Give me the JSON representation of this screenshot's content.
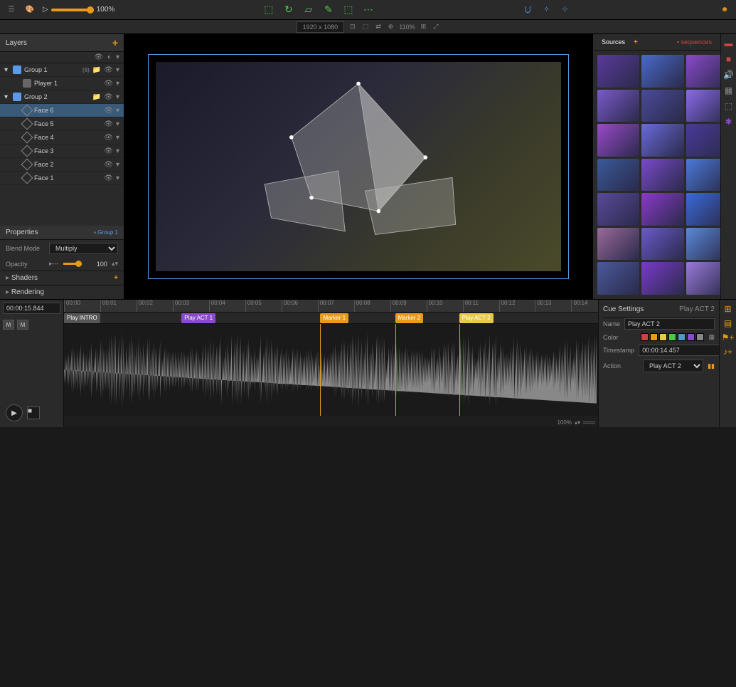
{
  "toolbar": {
    "zoom_percent": "100%",
    "canvas_dimensions": "1920 x 1080",
    "transform_percent": "110%"
  },
  "layers_panel": {
    "title": "Layers",
    "items": [
      {
        "name": "Group 1",
        "type": "group",
        "count": "(6)",
        "expanded": true,
        "selected": false
      },
      {
        "name": "Player 1",
        "type": "layer",
        "child": true,
        "selected": false
      },
      {
        "name": "Group 2",
        "type": "group",
        "expanded": true,
        "selected": false
      },
      {
        "name": "Face 6",
        "type": "face",
        "child": true,
        "selected": true
      },
      {
        "name": "Face 5",
        "type": "face",
        "child": true,
        "selected": false
      },
      {
        "name": "Face 4",
        "type": "face",
        "child": true,
        "selected": false
      },
      {
        "name": "Face 3",
        "type": "face",
        "child": true,
        "selected": false
      },
      {
        "name": "Face 2",
        "type": "face",
        "child": true,
        "selected": false
      },
      {
        "name": "Face 1",
        "type": "face",
        "child": true,
        "selected": false
      }
    ]
  },
  "properties": {
    "title": "Properties",
    "context": "Group 1",
    "blend_mode_label": "Blend Mode",
    "blend_mode_value": "Multiply",
    "opacity_label": "Opacity",
    "opacity_value": "100",
    "sections": [
      "Shaders",
      "Rendering"
    ]
  },
  "sources_panel": {
    "title": "Sources",
    "tab_sequences": "sequences",
    "thumb_colors": [
      "#5a3a9a",
      "#4a6aca",
      "#8a4aca",
      "#3a4a9a",
      "#6a3a8a",
      "#7a5aca",
      "#4a4a9a",
      "#8a6aea",
      "#5a4aba",
      "#3a3a8a",
      "#9a4aca",
      "#6a6ada",
      "#4a3a9a",
      "#8a5aea",
      "#5a3aba",
      "#3a5a9a",
      "#7a4aca",
      "#4a7ada",
      "#9a5aea",
      "#6a4aba",
      "#5a4a9a",
      "#8a3aca",
      "#3a6ada",
      "#7a5aea",
      "#4a3aba",
      "#9a6a9a",
      "#6a5aca",
      "#5a8ada",
      "#3a4aea",
      "#8a6aba",
      "#4a5a9a",
      "#7a3aca",
      "#9a7ada",
      "#6a5aea",
      "#5a6aba"
    ]
  },
  "timeline": {
    "timecode": "00:00:15.844",
    "mute_label": "M",
    "solo_label": "M",
    "ruler_ticks": [
      "00:00",
      "00:01",
      "00:02",
      "00:03",
      "00:04",
      "00:05",
      "00:06",
      "00:07",
      "00:08",
      "00:09",
      "00:10",
      "00:11",
      "00:12",
      "00:13",
      "00:14"
    ],
    "cues": [
      {
        "label": "Play INTRO",
        "pos": 0,
        "color": "#555"
      },
      {
        "label": "Play ACT 1",
        "pos": 22,
        "color": "#8a4aca"
      },
      {
        "label": "Marker 1",
        "pos": 48,
        "color": "#e89a1a"
      },
      {
        "label": "Marker 2",
        "pos": 62,
        "color": "#e89a1a"
      },
      {
        "label": "Play ACT 2",
        "pos": 74,
        "color": "#e8ca4a"
      }
    ],
    "zoom_value": "100%"
  },
  "cue_settings": {
    "title": "Cue Settings",
    "selected": "Play ACT 2",
    "name_label": "Name",
    "name_value": "Play ACT 2",
    "color_label": "Color",
    "colors": [
      "#c44",
      "#e89a1a",
      "#e8ca4a",
      "#4aca4a",
      "#4a9aca",
      "#8a4aca",
      "#888"
    ],
    "timestamp_label": "Timestamp",
    "timestamp_value": "00:00:14.457",
    "action_label": "Action",
    "action_value": "Play ACT 2"
  }
}
